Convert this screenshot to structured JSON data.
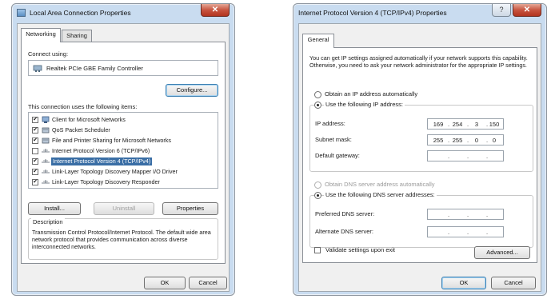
{
  "left_window": {
    "title": "Local Area Connection Properties",
    "close_label": "✕",
    "tabs": [
      {
        "label": "Networking"
      },
      {
        "label": "Sharing"
      }
    ],
    "connect_using_label": "Connect using:",
    "adapter_name": "Realtek PCIe GBE Family Controller",
    "configure_button": "Configure...",
    "items_label": "This connection uses the following items:",
    "items": [
      {
        "label": "Client for Microsoft Networks",
        "checked": true,
        "icon": "network-client-icon",
        "selected": false
      },
      {
        "label": "QoS Packet Scheduler",
        "checked": true,
        "icon": "network-service-icon",
        "selected": false
      },
      {
        "label": "File and Printer Sharing for Microsoft Networks",
        "checked": true,
        "icon": "network-service-icon",
        "selected": false
      },
      {
        "label": "Internet Protocol Version 6 (TCP/IPv6)",
        "checked": false,
        "icon": "protocol-icon",
        "selected": false
      },
      {
        "label": "Internet Protocol Version 4 (TCP/IPv4)",
        "checked": true,
        "icon": "protocol-icon",
        "selected": true
      },
      {
        "label": "Link-Layer Topology Discovery Mapper I/O Driver",
        "checked": true,
        "icon": "protocol-icon",
        "selected": false
      },
      {
        "label": "Link-Layer Topology Discovery Responder",
        "checked": true,
        "icon": "protocol-icon",
        "selected": false
      }
    ],
    "install_button": "Install...",
    "uninstall_button": "Uninstall",
    "properties_button": "Properties",
    "description_title": "Description",
    "description_text": "Transmission Control Protocol/Internet Protocol. The default wide area network protocol that provides communication across diverse interconnected networks.",
    "ok_button": "OK",
    "cancel_button": "Cancel"
  },
  "right_window": {
    "title": "Internet Protocol Version 4 (TCP/IPv4) Properties",
    "help_label": "?",
    "close_label": "✕",
    "tabs": [
      {
        "label": "General"
      }
    ],
    "intro_text": "You can get IP settings assigned automatically if your network supports this capability. Otherwise, you need to ask your network administrator for the appropriate IP settings.",
    "obtain_ip_auto": "Obtain an IP address automatically",
    "use_following_ip": "Use the following IP address:",
    "ip_address_label": "IP address:",
    "ip_address": [
      "169",
      "254",
      "3",
      "150"
    ],
    "subnet_mask_label": "Subnet mask:",
    "subnet_mask": [
      "255",
      "255",
      "0",
      "0"
    ],
    "default_gateway_label": "Default gateway:",
    "default_gateway": [
      "",
      "",
      "",
      ""
    ],
    "obtain_dns_auto": "Obtain DNS server address automatically",
    "use_following_dns": "Use the following DNS server addresses:",
    "preferred_dns_label": "Preferred DNS server:",
    "preferred_dns": [
      "",
      "",
      "",
      ""
    ],
    "alternate_dns_label": "Alternate DNS server:",
    "alternate_dns": [
      "",
      "",
      "",
      ""
    ],
    "validate_label": "Validate settings upon exit",
    "advanced_button": "Advanced...",
    "ok_button": "OK",
    "cancel_button": "Cancel",
    "ip_dot": "."
  }
}
